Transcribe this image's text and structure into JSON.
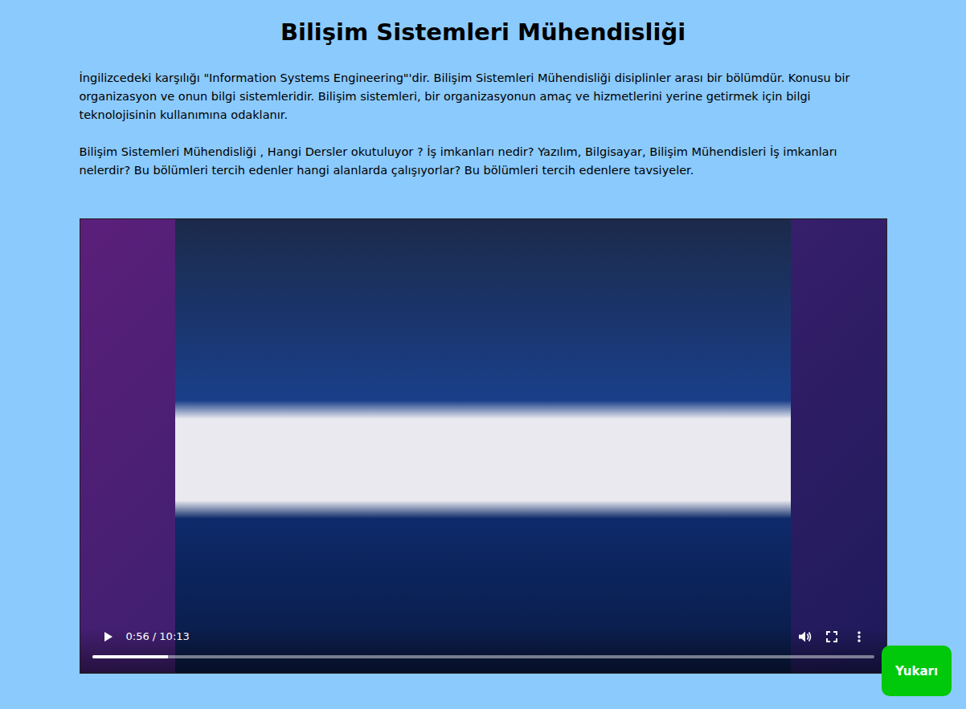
{
  "page": {
    "title": "Bilişim Sistemleri Mühendisliği"
  },
  "paragraphs": [
    "İngilizcedeki karşılığı \"Information Systems Engineering\"'dir. Bilişim Sistemleri Mühendisliği disiplinler arası bir bölümdür. Konusu bir organizasyon ve onun bilgi sistemleridir. Bilişim sistemleri, bir organizasyonun amaç ve hizmetlerini yerine getirmek için bilgi teknolojisinin kullanımına odaklanır.",
    "Bilişim Sistemleri Mühendisliği , Hangi Dersler okutuluyor ? İş imkanları nedir? Yazılım, Bilgisayar, Bilişim Mühendisleri İş imkanları nelerdir? Bu bölümleri tercih edenler hangi alanlarda çalışıyorlar? Bu bölümleri tercih edenlere tavsiyeler."
  ],
  "video": {
    "time": "0:56 / 10:13",
    "level": 0.097,
    "playing": false,
    "muted": false
  },
  "scroll_top_button": {
    "label": "Yukarı"
  }
}
